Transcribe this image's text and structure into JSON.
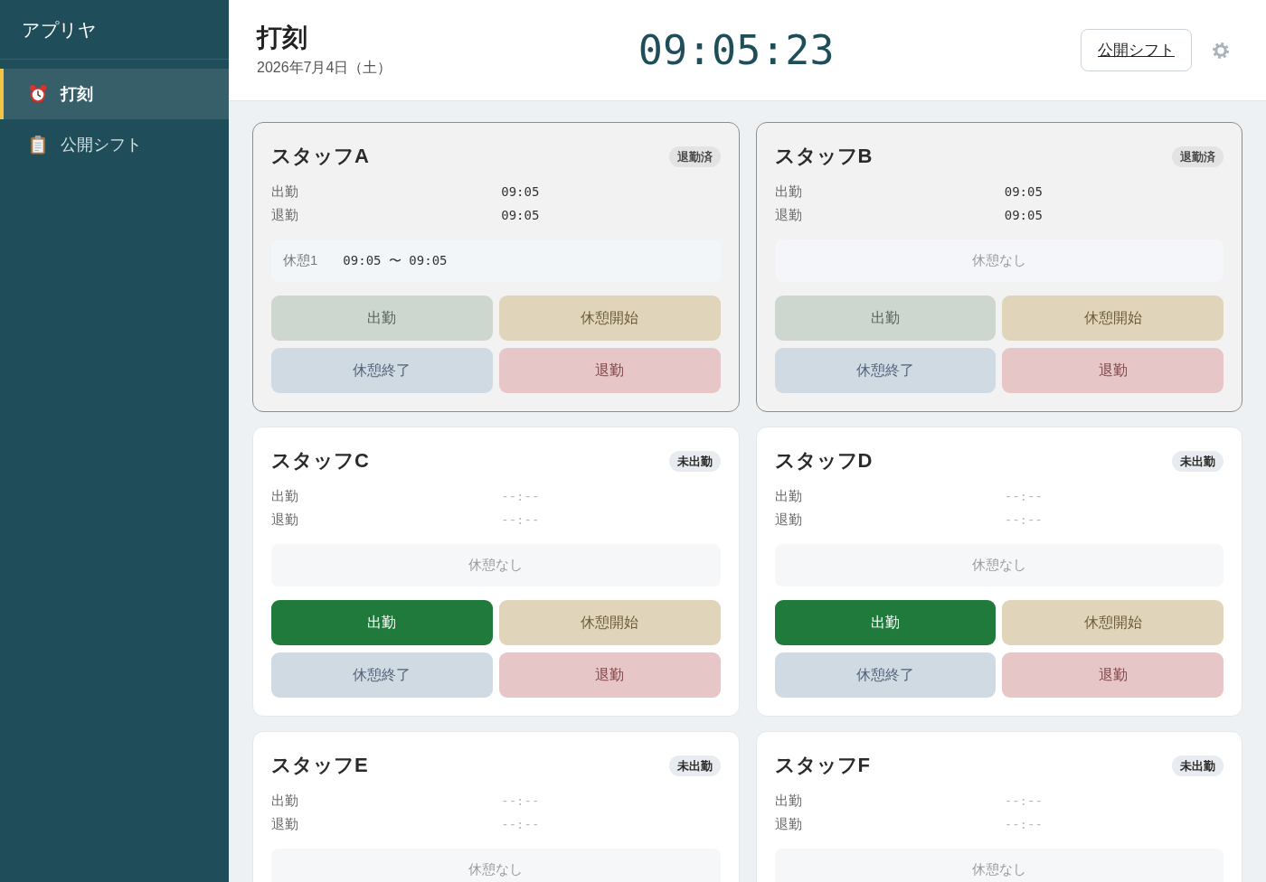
{
  "sidebar": {
    "title": "アプリヤ",
    "items": [
      {
        "label": "打刻",
        "kind": "punch",
        "selected": true
      },
      {
        "label": "公開シフト",
        "kind": "shift_list",
        "selected": false
      }
    ]
  },
  "header": {
    "title": "打刻",
    "date": "2026年7月4日（土）",
    "clock": "09:05:23",
    "link": "公開シフト"
  },
  "staff": [
    {
      "name": "スタッフA",
      "status": {
        "text": "退勤済",
        "kind": "done"
      },
      "times": [
        {
          "label": "出勤",
          "value": "09:05",
          "recorded": true
        },
        {
          "label": "退勤",
          "value": "09:05",
          "recorded": true
        }
      ],
      "breaks": [
        {
          "label": "休憩1",
          "time": "09:05 〜 09:05"
        }
      ],
      "buttons": [
        {
          "label": "出勤",
          "kind": "clock_in",
          "disabled": true
        },
        {
          "label": "休憩開始",
          "kind": "break_start",
          "disabled": true
        },
        {
          "label": "休憩終了",
          "kind": "break_end",
          "disabled": true
        },
        {
          "label": "退勤",
          "kind": "clock_out",
          "disabled": true
        }
      ]
    },
    {
      "name": "スタッフB",
      "status": {
        "text": "退勤済",
        "kind": "done"
      },
      "times": [
        {
          "label": "出勤",
          "value": "09:05",
          "recorded": true
        },
        {
          "label": "退勤",
          "value": "09:05",
          "recorded": true
        }
      ],
      "no_break": "休憩なし",
      "buttons": [
        {
          "label": "出勤",
          "kind": "clock_in",
          "disabled": true
        },
        {
          "label": "休憩開始",
          "kind": "break_start",
          "disabled": true
        },
        {
          "label": "休憩終了",
          "kind": "break_end",
          "disabled": true
        },
        {
          "label": "退勤",
          "kind": "clock_out",
          "disabled": true
        }
      ]
    },
    {
      "name": "スタッフC",
      "status": {
        "text": "未出勤",
        "kind": "not_started"
      },
      "times": [
        {
          "label": "出勤",
          "value": "--:--",
          "recorded": false
        },
        {
          "label": "退勤",
          "value": "--:--",
          "recorded": false
        }
      ],
      "no_break": "休憩なし",
      "buttons": [
        {
          "label": "出勤",
          "kind": "clock_in",
          "disabled": false
        },
        {
          "label": "休憩開始",
          "kind": "break_start",
          "disabled": true
        },
        {
          "label": "休憩終了",
          "kind": "break_end",
          "disabled": true
        },
        {
          "label": "退勤",
          "kind": "clock_out",
          "disabled": true
        }
      ]
    },
    {
      "name": "スタッフD",
      "status": {
        "text": "未出勤",
        "kind": "not_started"
      },
      "times": [
        {
          "label": "出勤",
          "value": "--:--",
          "recorded": false
        },
        {
          "label": "退勤",
          "value": "--:--",
          "recorded": false
        }
      ],
      "no_break": "休憩なし",
      "buttons": [
        {
          "label": "出勤",
          "kind": "clock_in",
          "disabled": false
        },
        {
          "label": "休憩開始",
          "kind": "break_start",
          "disabled": true
        },
        {
          "label": "休憩終了",
          "kind": "break_end",
          "disabled": true
        },
        {
          "label": "退勤",
          "kind": "clock_out",
          "disabled": true
        }
      ]
    },
    {
      "name": "スタッフE",
      "status": {
        "text": "未出勤",
        "kind": "not_started"
      },
      "times": [
        {
          "label": "出勤",
          "value": "--:--",
          "recorded": false
        },
        {
          "label": "退勤",
          "value": "--:--",
          "recorded": false
        }
      ],
      "no_break": "休憩なし"
    },
    {
      "name": "スタッフF",
      "status": {
        "text": "未出勤",
        "kind": "not_started"
      },
      "times": [
        {
          "label": "出勤",
          "value": "--:--",
          "recorded": false
        },
        {
          "label": "退勤",
          "value": "--:--",
          "recorded": false
        }
      ],
      "no_break": "休憩なし"
    }
  ]
}
